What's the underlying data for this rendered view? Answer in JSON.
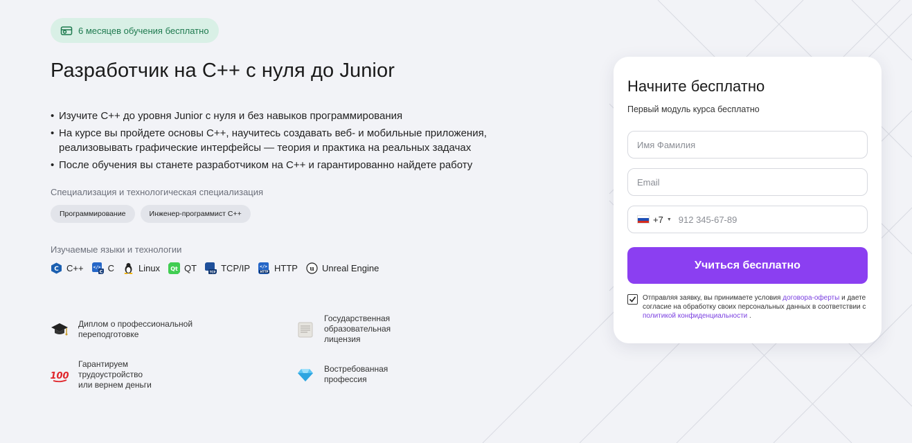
{
  "promo": {
    "text": "6 месяцев обучения бесплатно",
    "icon": "gift-card-icon"
  },
  "course": {
    "title": "Разработчик на C++ с нуля до Junior",
    "bullets": [
      "Изучите C++ до уровня Junior с нуля и без навыков программирования",
      "На курсе вы пройдете основы C++, научитесь создавать веб- и мобильные приложения, реализовывать графические интерфейсы — теория и практика на реальных задачах",
      "После обучения вы станете разработчиком на C++ и гарантированно найдете работу"
    ]
  },
  "specialization": {
    "label": "Специализация и технологическая специализация",
    "chips": [
      "Программирование",
      "Инженер-программист C++"
    ]
  },
  "technologies": {
    "label": "Изучаемые языки и технологии",
    "items": [
      {
        "name": "C++",
        "icon": "cpp-icon"
      },
      {
        "name": "C",
        "icon": "c-icon"
      },
      {
        "name": "Linux",
        "icon": "linux-icon"
      },
      {
        "name": "QT",
        "icon": "qt-icon"
      },
      {
        "name": "TCP/IP",
        "icon": "tcpip-icon"
      },
      {
        "name": "HTTP",
        "icon": "http-icon"
      },
      {
        "name": "Unreal Engine",
        "icon": "unreal-engine-icon"
      }
    ]
  },
  "features": [
    {
      "text": "Диплом о профессиональной\nпереподготовке",
      "icon": "graduation-cap-icon"
    },
    {
      "text": "Государственная\nобразовательная\nлицензия",
      "icon": "document-icon"
    },
    {
      "text": "Гарантируем\nтрудоустройство\nили вернем деньги",
      "icon": "hundred-points-icon"
    },
    {
      "text": "Востребованная\nпрофессия",
      "icon": "diamond-icon"
    }
  ],
  "form": {
    "title": "Начните бесплатно",
    "subtitle": "Первый модуль курса бесплатно",
    "name_placeholder": "Имя Фамилия",
    "email_placeholder": "Email",
    "phone_code": "+7",
    "phone_placeholder": "912 345-67-89",
    "submit_label": "Учиться бесплатно",
    "consent_prefix": "Отправляя заявку, вы принимаете условия ",
    "consent_link1": "договора-оферты",
    "consent_middle": " и даете согласие на обработку своих персональных данных в соответствии с ",
    "consent_link2": "политикой конфиденциальности",
    "consent_suffix": " .",
    "consent_checked": true
  },
  "colors": {
    "accent": "#8b3ff1",
    "promo_bg": "#d9f0e6",
    "promo_text": "#1e7a4f",
    "link": "#7a3fe0"
  }
}
